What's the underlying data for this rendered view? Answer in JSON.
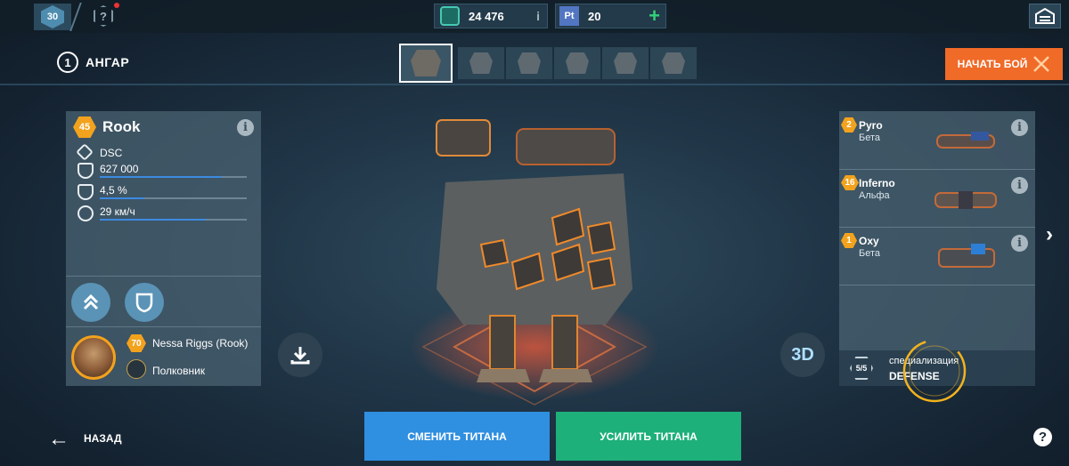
{
  "topbar": {
    "level": "30",
    "currency_au": "24 476",
    "currency_pt_icon": "Pt",
    "currency_pt": "20",
    "au_info": "i",
    "pt_plus": "+"
  },
  "header": {
    "hangar_number": "1",
    "hangar_label": "АНГАР",
    "start_battle": "НАЧАТЬ БОЙ",
    "thumbnails_count": 6
  },
  "titan": {
    "level": "45",
    "name": "Rook",
    "info": "i",
    "stats": [
      {
        "icon": "dsc-icon",
        "label": "DSC"
      },
      {
        "icon": "health-icon",
        "label": "627 000",
        "fill": 0.83
      },
      {
        "icon": "defense-icon",
        "label": "4,5 %",
        "fill": 0.3
      },
      {
        "icon": "speed-icon",
        "label": "29 км/ч",
        "fill": 0.72
      }
    ]
  },
  "pilot": {
    "level": "70",
    "name": "Nessa Riggs (Rook)",
    "rank": "Полковник"
  },
  "weapons": [
    {
      "level": "2",
      "name": "Pyro",
      "tier": "Бета"
    },
    {
      "level": "16",
      "name": "Inferno",
      "tier": "Альфа"
    },
    {
      "level": "1",
      "name": "Oxy",
      "tier": "Бета"
    }
  ],
  "specialization": {
    "count": "5/5",
    "label": "специализация",
    "value": "DEFENSE"
  },
  "bottom": {
    "back": "НАЗАД",
    "change_titan": "СМЕНИТЬ ТИТАНА",
    "upgrade_titan": "УСИЛИТЬ ТИТАНА",
    "help": "?",
    "view_3d": "3D"
  },
  "colors": {
    "accent_orange": "#f06a28",
    "level_badge": "#f3a21d",
    "blue_button": "#2f8fe0",
    "green_button": "#1db07a",
    "stat_bar": "#3d8ae0"
  }
}
